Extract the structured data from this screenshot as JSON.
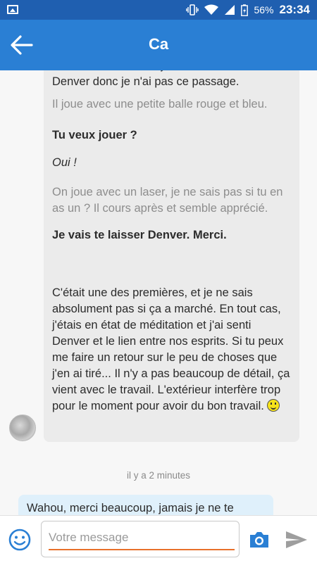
{
  "status_bar": {
    "battery": "56%",
    "time": "23:34"
  },
  "header": {
    "title": "Ca",
    "back_icon": "arrow-left-icon"
  },
  "thread": {
    "incoming_message": {
      "lines": [
        "avec l'extérieur mais j'ai réussi à rester avec Denver donc je n'ai pas ce passage.",
        "Il joue avec une petite balle rouge et bleu.",
        "Tu veux jouer ?",
        "Oui !",
        "On joue avec un laser, je ne sais pas si tu en as un ? Il cours après et semble apprécié.",
        "Je vais te laisser Denver. Merci.",
        "C'était une des premières, et je ne sais absolument pas si ça a marché. En tout cas, j'étais en état de méditation et j'ai senti Denver et le lien entre nos esprits. Si tu peux me faire un retour sur le peu de choses que j'en ai tiré... Il n'y a pas beaucoup de détail, ça vient avec le travail. L'extérieur interfère trop pour le moment pour avoir du bon travail."
      ],
      "emoji": "smiley-icon"
    },
    "timestamp": "il y a 2 minutes",
    "outgoing_message": "Wahou, merci beaucoup, jamais je ne te"
  },
  "composer": {
    "placeholder": "Votre message",
    "value": "",
    "emoji_icon": "smiley-icon",
    "camera_icon": "camera-icon",
    "send_icon": "send-icon"
  },
  "colors": {
    "status_bar": "#1f5fb0",
    "app_bar": "#2a7fd4",
    "incoming_bubble": "#ebebeb",
    "outgoing_bubble": "#dff0fb",
    "input_underline": "#e8702a",
    "accent_icon": "#2a7fd4"
  }
}
